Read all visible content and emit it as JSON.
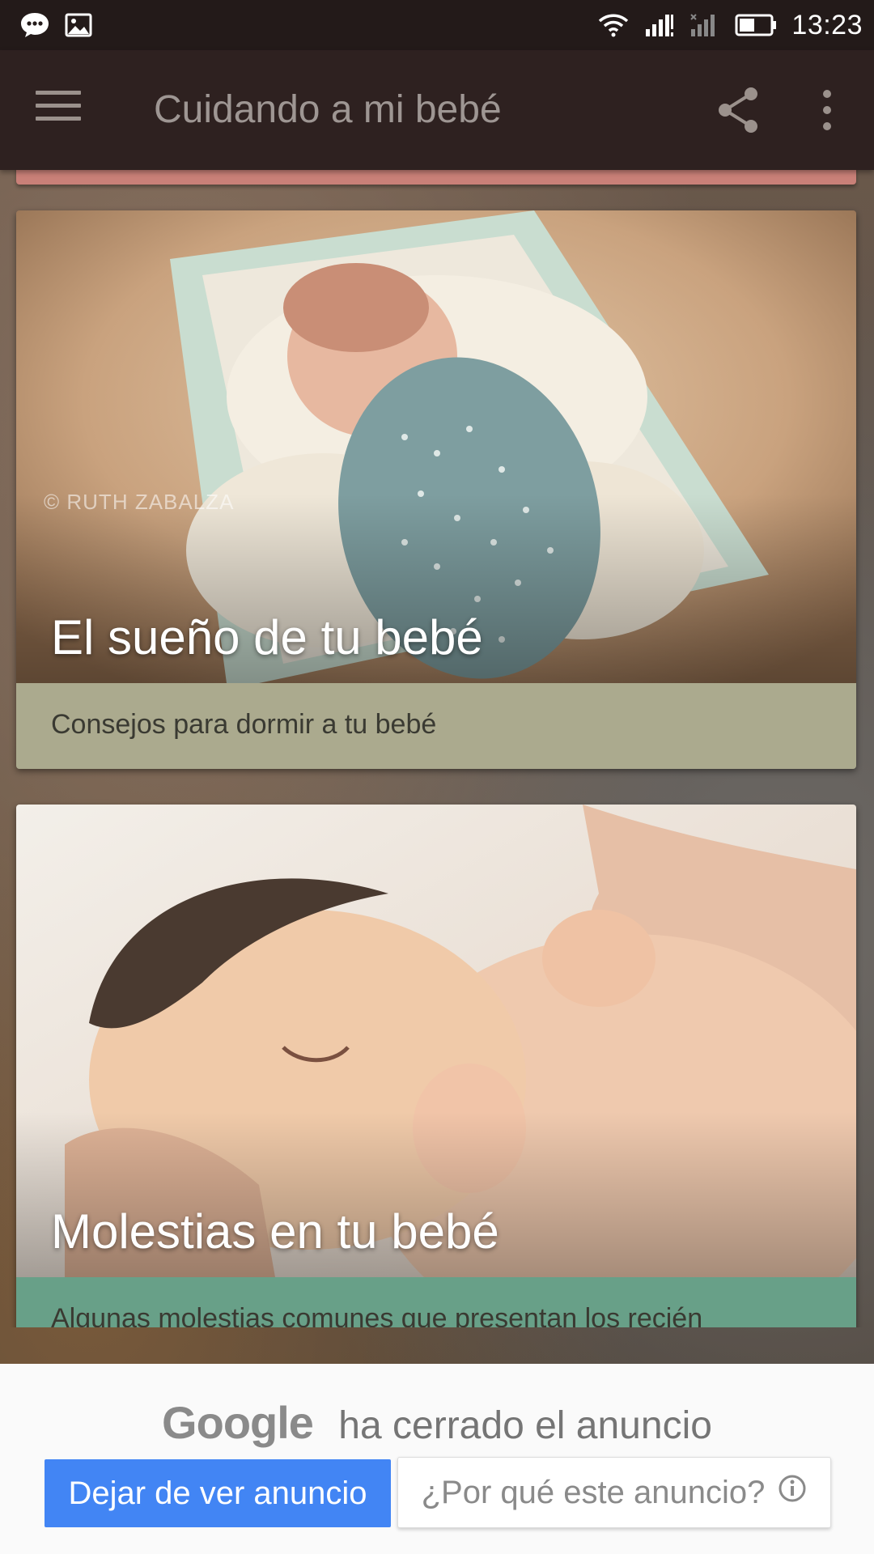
{
  "status_bar": {
    "time": "13:23",
    "icons": [
      "message-icon",
      "image-icon",
      "wifi-icon",
      "signal-icon",
      "signal-no-sim-icon",
      "battery-icon"
    ]
  },
  "app_bar": {
    "title": "Cuidando a mi bebé",
    "icons": [
      "hamburger-menu-icon",
      "share-icon",
      "more-vert-icon"
    ]
  },
  "cards": [
    {
      "title": "El sueño de tu bebé",
      "subtitle": "Consejos para dormir a tu bebé",
      "watermark": "© RUTH  ZABALZA",
      "subtitle_color": "#abaa8e"
    },
    {
      "title": "Molestias en tu bebé",
      "subtitle": "Algunas molestias comunes que presentan los recién",
      "subtitle_color": "#68a088"
    }
  ],
  "ad": {
    "brand": "Google",
    "closed_text": "ha cerrado el anuncio",
    "stop_button": "Dejar de ver anuncio",
    "why_button": "¿Por qué este anuncio?",
    "accent": "#4285f4"
  }
}
